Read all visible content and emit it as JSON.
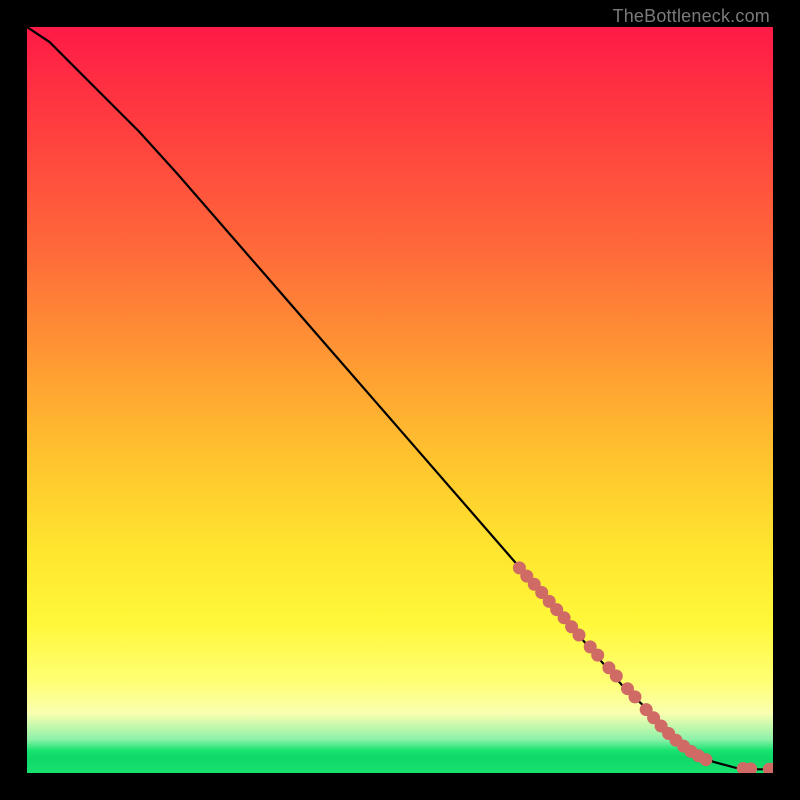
{
  "attribution": "TheBottleneck.com",
  "chart_data": {
    "type": "line",
    "title": "",
    "xlabel": "",
    "ylabel": "",
    "xlim": [
      0,
      100
    ],
    "ylim": [
      0,
      100
    ],
    "grid": false,
    "legend": false,
    "series": [
      {
        "name": "curve",
        "x": [
          0,
          3,
          6,
          10,
          15,
          20,
          30,
          40,
          50,
          60,
          70,
          80,
          88,
          92,
          95,
          98,
          100
        ],
        "y": [
          100,
          98,
          95,
          91,
          86,
          80.5,
          69,
          57.5,
          46,
          34.5,
          23,
          11.5,
          4,
          1.5,
          0.7,
          0.5,
          0.5
        ]
      }
    ],
    "scatter_points": {
      "name": "markers",
      "x": [
        66,
        67,
        68,
        69,
        70,
        71,
        72,
        73,
        74,
        75.5,
        76.5,
        78,
        79,
        80.5,
        81.5,
        83,
        84,
        85,
        86,
        87,
        88,
        89,
        90,
        91,
        96,
        97,
        99.5,
        100
      ],
      "y": [
        27.5,
        26.4,
        25.3,
        24.2,
        23.0,
        21.9,
        20.8,
        19.6,
        18.5,
        16.9,
        15.8,
        14.1,
        13.0,
        11.3,
        10.2,
        8.5,
        7.4,
        6.3,
        5.3,
        4.4,
        3.6,
        2.9,
        2.3,
        1.8,
        0.6,
        0.55,
        0.5,
        0.5
      ]
    },
    "gradient_stops": [
      {
        "pos": 0.0,
        "color": "#ff1a47"
      },
      {
        "pos": 0.3,
        "color": "#ff6a3a"
      },
      {
        "pos": 0.58,
        "color": "#ffc42e"
      },
      {
        "pos": 0.8,
        "color": "#fff83a"
      },
      {
        "pos": 0.92,
        "color": "#faffb0"
      },
      {
        "pos": 0.97,
        "color": "#17e36f"
      },
      {
        "pos": 1.0,
        "color": "#17e36f"
      }
    ]
  }
}
